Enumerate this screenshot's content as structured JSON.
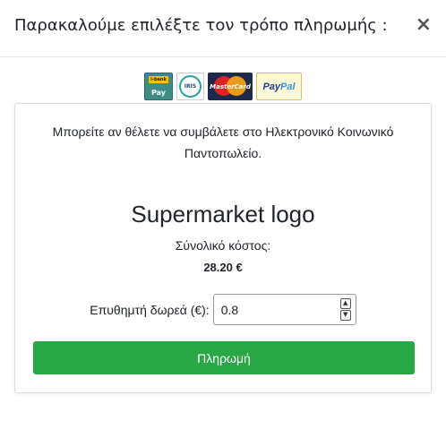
{
  "modal": {
    "title": "Παρακαλούμε επιλέξτε τον τρόπο πληρωμής :",
    "close_label": "×"
  },
  "payment_logos": [
    {
      "name": "ibank-pay",
      "text_top": "i-bank",
      "text_bottom": "Pay"
    },
    {
      "name": "iris",
      "text": "IRIS"
    },
    {
      "name": "mastercard",
      "text": "MasterCard"
    },
    {
      "name": "paypal",
      "text_a": "Pay",
      "text_b": "Pal"
    }
  ],
  "card": {
    "intro": "Μπορείτε αν θέλετε να συμβάλετε στο Ηλεκτρονικό Κοινωνικό Παντοπωλείο.",
    "store_name": "Supermarket logo",
    "total_cost_label": "Σύνολικό κόστος:",
    "total_cost_value": "28.20 €",
    "donation_label": "Επυθημτή δωρεά (€):",
    "donation_value": "0.8",
    "pay_button": "Πληρωμή"
  },
  "colors": {
    "accent": "#28a745",
    "border": "#dcdcdc"
  }
}
